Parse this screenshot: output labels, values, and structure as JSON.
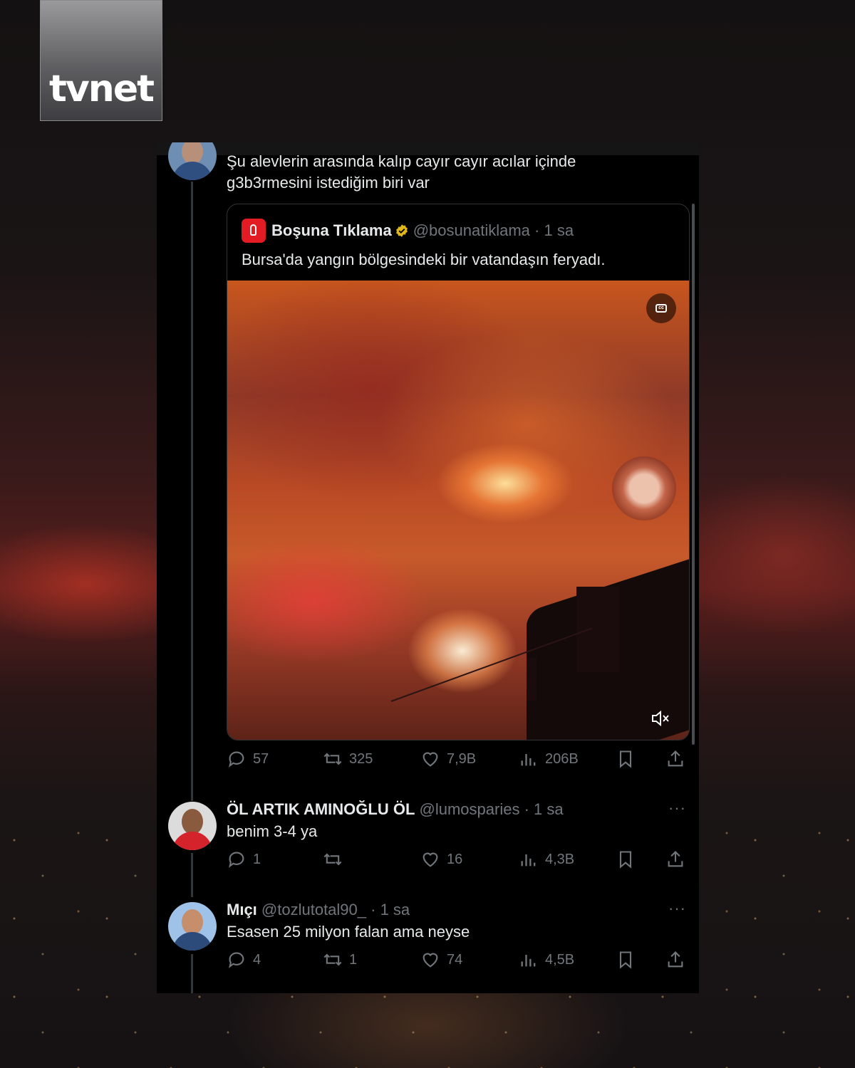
{
  "logo": {
    "text": "tvnet"
  },
  "thread": {
    "top_tweet": {
      "text_line1": "Şu alevlerin arasında kalıp cayır cayır acılar içinde",
      "text_line2": "g3b3rmesini istediğim biri var"
    },
    "quoted": {
      "name": "Boşuna Tıklama",
      "handle": "@bosunatiklama",
      "time": "· 1 sa",
      "text": "Bursa'da yangın bölgesindeki bir vatandaşın feryadı.",
      "verified_color": "#e2b719"
    },
    "top_actions": {
      "replies": "57",
      "retweets": "325",
      "likes": "7,9B",
      "views": "206B"
    },
    "replies": [
      {
        "name": "ÖL ARTIK AMINOĞLU ÖL",
        "handle": "@lumosparies",
        "time": "· 1 sa",
        "text": "benim 3-4 ya",
        "actions": {
          "replies": "1",
          "retweets": "",
          "likes": "16",
          "views": "4,3B"
        },
        "more": "···"
      },
      {
        "name": "Mıçı",
        "handle": "@tozlutotal90_",
        "time": "· 1 sa",
        "text": "Esasen 25 milyon falan ama neyse",
        "actions": {
          "replies": "4",
          "retweets": "1",
          "likes": "74",
          "views": "4,5B"
        },
        "more": "···"
      }
    ]
  },
  "colors": {
    "panel_bg": "#000000",
    "text": "#e7e9ea",
    "muted": "#71767b",
    "accent_red": "#e31b23"
  },
  "icons": [
    "reply-icon",
    "retweet-icon",
    "like-icon",
    "views-icon",
    "bookmark-icon",
    "share-icon",
    "cc-icon",
    "mute-icon",
    "verified-icon",
    "more-icon"
  ]
}
